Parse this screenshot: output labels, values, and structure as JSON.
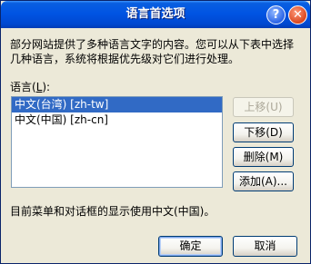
{
  "window": {
    "title": "语言首选项",
    "help_label": "?",
    "close_label": "✕"
  },
  "intro_text": "部分网站提供了多种语言文字的内容。您可以从下表中选择几种语言，系统将根据优先级对它们进行处理。",
  "language_label_prefix": "语言(",
  "language_label_key": "L",
  "language_label_suffix": "):",
  "languages": [
    {
      "label": "中文(台湾) [zh-tw]",
      "selected": true
    },
    {
      "label": "中文(中国) [zh-cn]",
      "selected": false
    }
  ],
  "buttons": {
    "move_up": "上移(U)",
    "move_down": "下移(D)",
    "remove": "删除(M)",
    "add": "添加(A)...",
    "ok": "确定",
    "cancel": "取消"
  },
  "status_text": "目前菜单和对话框的显示使用中文(中国)。",
  "colors": {
    "titlebar": "#0054e3",
    "selection": "#316ac5",
    "dialog_bg": "#ece9d8"
  }
}
